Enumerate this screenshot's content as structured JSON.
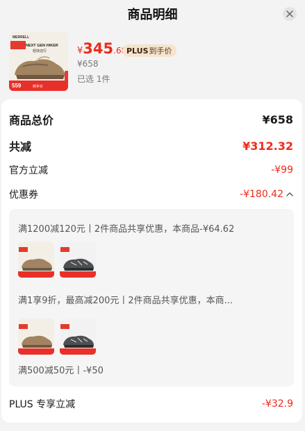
{
  "header": {
    "title": "商品明细"
  },
  "product": {
    "price_currency": "¥",
    "price_integer": "345",
    "price_decimal": ".68",
    "plus_badge_label": "PLUS",
    "plus_badge_text": "到手价",
    "original_price": "¥658",
    "selected_count": "已选 1件",
    "thumb_brand": "MERRELL",
    "thumb_headline": "NEXT GEN HIKER",
    "thumb_tag": "轻快迈行",
    "thumb_promo": "559",
    "thumb_promo_side": "到手价"
  },
  "summary": {
    "total_label": "商品总价",
    "total_value": "¥658",
    "reduce_label": "共减",
    "reduce_value": "¥312.32",
    "official_label": "官方立减",
    "official_value": "-¥99",
    "coupon_label": "优惠券",
    "coupon_value": "-¥180.42",
    "plus_label": "PLUS 专享立减",
    "plus_value": "-¥32.9"
  },
  "coupons": [
    {
      "text": "满1200减120元丨2件商品共享优惠，本商品-¥64.62"
    },
    {
      "text": "满1享9折，最高减200元丨2件商品共享优惠，本商..."
    },
    {
      "text": "满500减50元丨-¥50"
    }
  ],
  "colors": {
    "accent_red": "#ee2a1b",
    "plus_gold": "#f6e4cf"
  }
}
